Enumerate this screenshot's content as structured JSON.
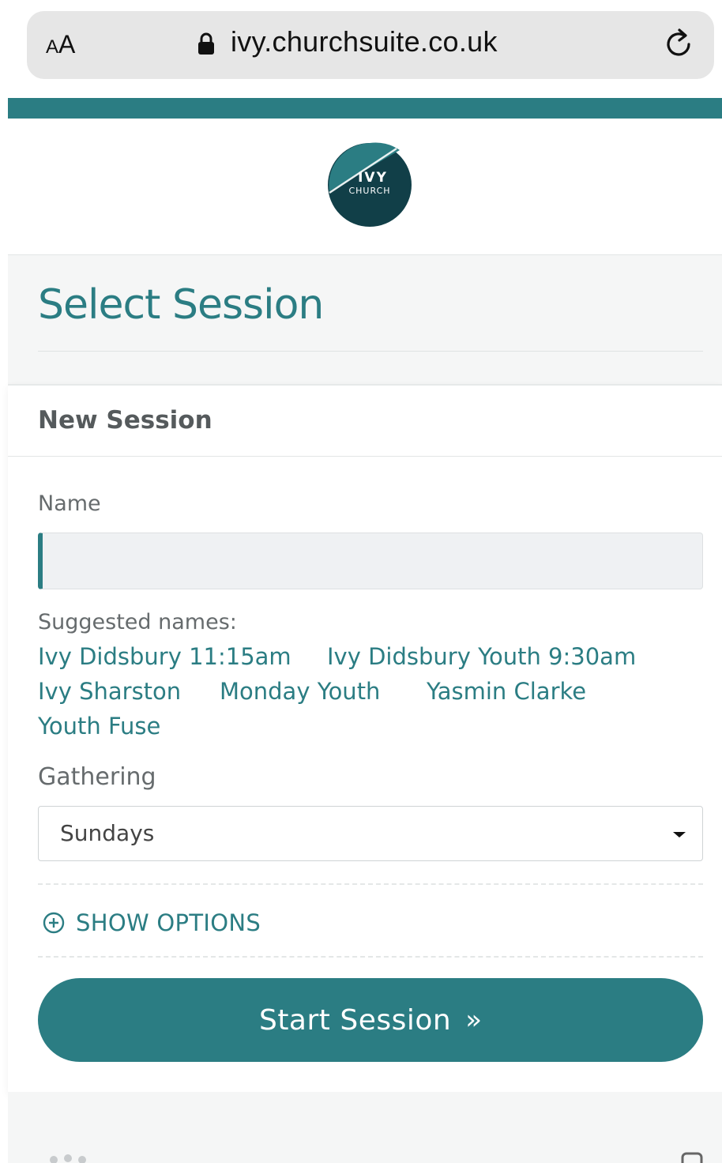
{
  "browser": {
    "text_size_small": "A",
    "text_size_large": "A",
    "url": "ivy.churchsuite.co.uk"
  },
  "logo": {
    "line1": "IVY",
    "line2": "CHURCH"
  },
  "page": {
    "title": "Select Session"
  },
  "session_form": {
    "heading": "New Session",
    "name_label": "Name",
    "name_value": "",
    "suggested_label": "Suggested names:",
    "suggestions": [
      "Ivy Didsbury 11:15am",
      "Ivy Didsbury Youth 9:30am",
      "Ivy Sharston",
      "Monday Youth",
      "Yasmin Clarke",
      "Youth Fuse"
    ],
    "gathering_label": "Gathering",
    "gathering_selected": "Sundays",
    "show_options_label": "SHOW OPTIONS",
    "start_button_label": "Start Session",
    "start_button_suffix": "»"
  },
  "colors": {
    "accent": "#2b7d83",
    "logo_dark": "#113f48",
    "header_bg": "#f5f6f6",
    "input_bg": "#eff1f3"
  },
  "icons": {
    "lock": "lock-icon",
    "reload": "reload-icon",
    "caret": "caret-down-icon",
    "show_options": "plus-circle-icon"
  }
}
